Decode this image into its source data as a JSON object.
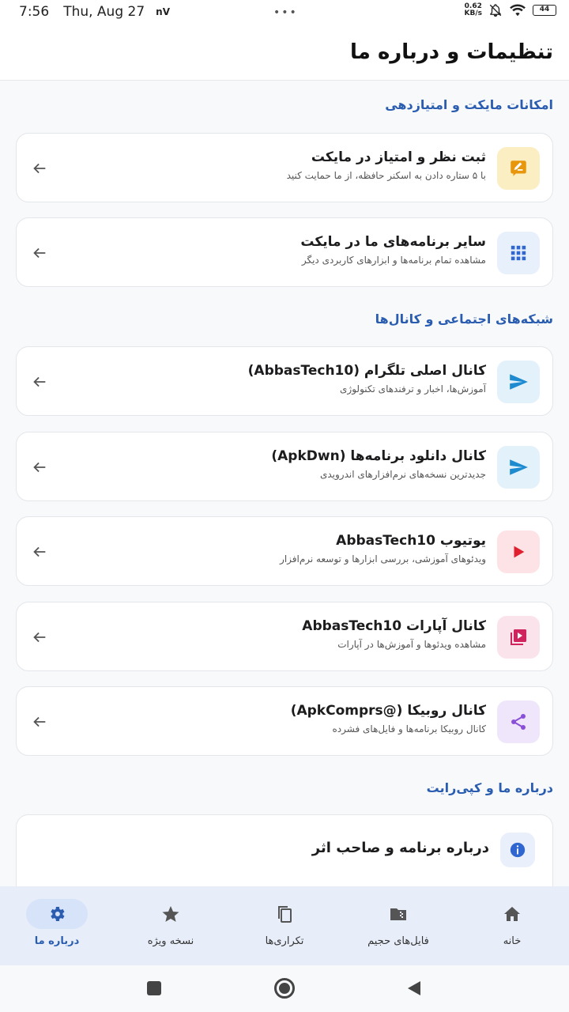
{
  "status_bar": {
    "time": "7:56",
    "date": "Thu, Aug 27",
    "carrier": "nV",
    "speed_value": "0.62",
    "speed_unit": "KB/s",
    "battery": "44"
  },
  "app_bar": {
    "title": "تنظیمات و درباره ما"
  },
  "sections": {
    "myket": "امکانات مایکت و امتیازدهی",
    "social": "شبکه‌های اجتماعی و کانال‌ها",
    "about": "درباره ما و کپی‌رایت"
  },
  "cards": {
    "rate": {
      "title": "ثبت نظر و امتیاز در مایکت",
      "subtitle": "با ۵ ستاره دادن به اسکنر حافظه، از ما حمایت کنید",
      "icon": "rate-review-icon",
      "color": "#e8960c"
    },
    "apps": {
      "title": "سایر برنامه‌های ما در مایکت",
      "subtitle": "مشاهده تمام برنامه‌ها و ابزارهای کاربردی دیگر",
      "icon": "apps-grid-icon",
      "color": "#2f66d0"
    },
    "telegram_main": {
      "title": "کانال اصلی تلگرام (AbbasTech10)",
      "subtitle": "آموزش‌ها، اخبار و ترفندهای تکنولوژی",
      "icon": "telegram-send-icon",
      "color": "#1e8bd0"
    },
    "telegram_apk": {
      "title": "کانال دانلود برنامه‌ها (ApkDwn)",
      "subtitle": "جدیدترین نسخه‌های نرم‌افزارهای اندرویدی",
      "icon": "telegram-send-icon",
      "color": "#1e8bd0"
    },
    "youtube": {
      "title": "یوتیوب AbbasTech10",
      "subtitle": "ویدئوهای آموزشی، بررسی ابزارها و توسعه نرم‌افزار",
      "icon": "youtube-play-icon",
      "color": "#e0202e"
    },
    "aparat": {
      "title": "کانال آپارات AbbasTech10",
      "subtitle": "مشاهده ویدئوها و آموزش‌ها در آپارات",
      "icon": "video-library-icon",
      "color": "#d0245e"
    },
    "rubika": {
      "title": "کانال روبیکا (@ApkComprs)",
      "subtitle": "کانال روبیکا برنامه‌ها و فایل‌های فشرده",
      "icon": "share-icon",
      "color": "#8a4fd8"
    }
  },
  "about_card": {
    "title": "درباره برنامه و صاحب اثر",
    "icon": "info-icon",
    "color": "#2f66d0"
  },
  "bottom_nav": [
    {
      "label": "درباره ما",
      "icon": "settings-gear-icon",
      "active": true
    },
    {
      "label": "نسخه ویژه",
      "icon": "star-icon",
      "active": false
    },
    {
      "label": "تکراری‌ها",
      "icon": "copy-icon",
      "active": false
    },
    {
      "label": "فایل‌های حجیم",
      "icon": "zip-folder-icon",
      "active": false
    },
    {
      "label": "خانه",
      "icon": "home-icon",
      "active": false
    }
  ],
  "system_nav": {
    "recents": "recents-square-icon",
    "home": "home-circle-icon",
    "back": "back-triangle-icon"
  }
}
